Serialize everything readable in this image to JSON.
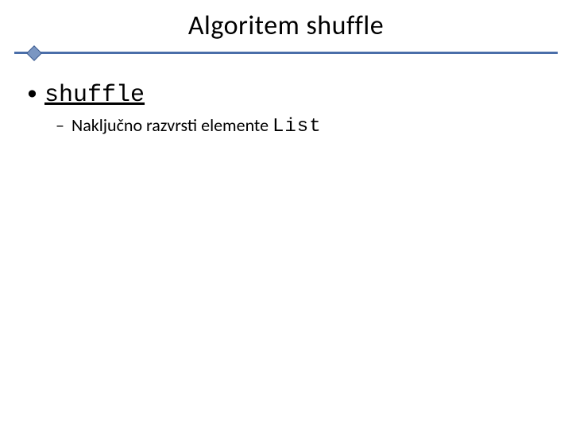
{
  "title": "Algoritem  shuffle",
  "bullets": {
    "item1": {
      "label": "shuffle",
      "sub1_prefix": "Naključno razvrsti elemente ",
      "sub1_code": "List"
    }
  }
}
